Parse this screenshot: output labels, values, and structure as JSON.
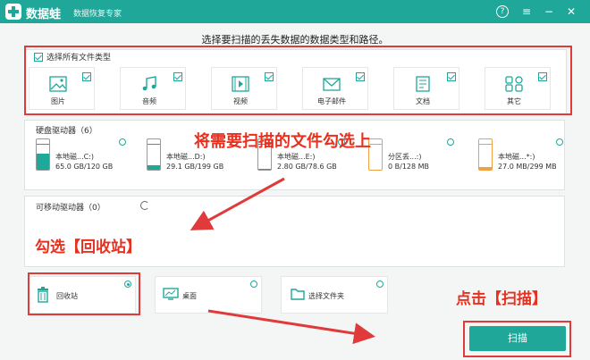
{
  "app": {
    "name": "数据蛙",
    "subtitle": "数据恢复专家",
    "icons": [
      "help-icon",
      "menu-icon",
      "minimize-icon",
      "close-icon"
    ]
  },
  "instruction": "选择要扫描的丢失数据的数据类型和路径。",
  "file_types": {
    "select_all_label": "选择所有文件类型",
    "items": [
      {
        "label": "图片",
        "icon": "image-icon",
        "checked": true
      },
      {
        "label": "音频",
        "icon": "music-icon",
        "checked": true
      },
      {
        "label": "视频",
        "icon": "video-icon",
        "checked": true
      },
      {
        "label": "电子邮件",
        "icon": "email-icon",
        "checked": true
      },
      {
        "label": "文档",
        "icon": "document-icon",
        "checked": true
      },
      {
        "label": "其它",
        "icon": "other-icon",
        "checked": true
      }
    ]
  },
  "hard_drives": {
    "title": "硬盘驱动器（6）",
    "drives": [
      {
        "name": "本地磁...C:)",
        "size": "65.0 GB/120 GB",
        "used_fraction": 0.54,
        "color": "#1fa79a"
      },
      {
        "name": "本地磁...D:)",
        "size": "29.1 GB/199 GB",
        "used_fraction": 0.15,
        "color": "#1fa79a"
      },
      {
        "name": "本地磁...E:)",
        "size": "2.80 GB/78.6 GB",
        "used_fraction": 0.04,
        "color": "#1fa79a"
      },
      {
        "name": "分区丢...:)",
        "size": "0 B/128 MB",
        "used_fraction": 0.0,
        "color": "#f0a040"
      },
      {
        "name": "本地磁...*:)",
        "size": "27.0 MB/299 MB",
        "used_fraction": 0.09,
        "color": "#f0a040"
      }
    ]
  },
  "removable": {
    "title": "可移动驱动器（0）"
  },
  "locations": [
    {
      "label": "回收站",
      "icon": "recycle-bin-icon",
      "selected": true
    },
    {
      "label": "桌面",
      "icon": "desktop-icon",
      "selected": false
    },
    {
      "label": "选择文件夹",
      "icon": "folder-icon",
      "selected": false
    }
  ],
  "scan_button": "扫描",
  "annotations": {
    "select_types": "将需要扫描的文件勾选上",
    "select_recycle": "勾选【回收站】",
    "click_scan": "点击【扫描】",
    "color": "#e8301f"
  },
  "colors": {
    "accent": "#1fa79a",
    "annotation": "#e03a3a"
  }
}
